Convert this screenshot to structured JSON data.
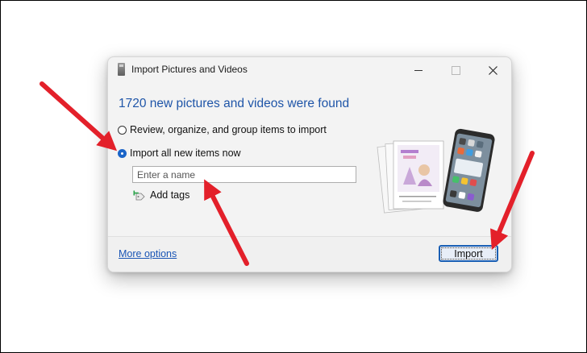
{
  "window": {
    "title": "Import Pictures and Videos",
    "icon": "camera-device-icon"
  },
  "main": {
    "heading": "1720 new pictures and videos were found",
    "options": [
      {
        "label": "Review, organize, and group items to import",
        "selected": false
      },
      {
        "label": "Import all new items now",
        "selected": true
      }
    ],
    "name_input": {
      "placeholder": "Enter a name",
      "value": ""
    },
    "add_tags_label": "Add tags"
  },
  "footer": {
    "more_options_label": "More options",
    "import_label": "Import"
  },
  "colors": {
    "heading": "#1f55a8",
    "link": "#1a55b5",
    "accent": "#1a64c8",
    "annotation_arrow": "#e3202a"
  },
  "annotations": {
    "arrows": [
      "arrow-to-import-all-option",
      "arrow-to-name-input",
      "arrow-to-import-button"
    ]
  }
}
